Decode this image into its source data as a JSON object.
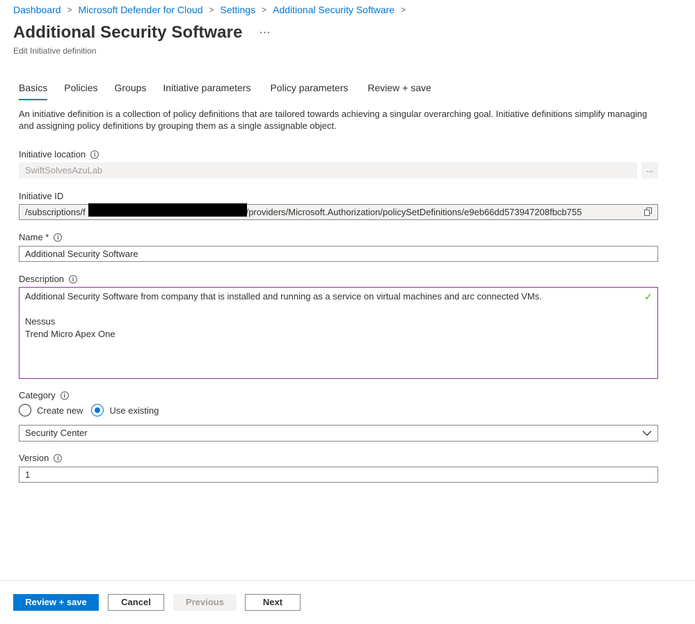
{
  "breadcrumb": [
    "Dashboard",
    "Microsoft Defender for Cloud",
    "Settings",
    "Additional Security Software"
  ],
  "page": {
    "title": "Additional Security Software",
    "more_label": "···",
    "subtitle": "Edit Initiative definition"
  },
  "tabs": [
    {
      "label": "Basics",
      "active": true
    },
    {
      "label": "Policies",
      "active": false
    },
    {
      "label": "Groups",
      "active": false
    },
    {
      "label": "Initiative parameters",
      "active": false
    },
    {
      "label": "Policy parameters",
      "active": false
    },
    {
      "label": "Review + save",
      "active": false
    }
  ],
  "intro": "An initiative definition is a collection of policy definitions that are tailored towards achieving a singular overarching goal. Initiative definitions simplify managing and assigning policy definitions by grouping them as a single assignable object.",
  "form": {
    "location": {
      "label": "Initiative location",
      "value": "SwiftSolvesAzuLab",
      "button": "..."
    },
    "initiative_id": {
      "label": "Initiative ID",
      "prefix": "/subscriptions/f",
      "suffix": "l/providers/Microsoft.Authorization/policySetDefinitions/e9eb66dd573947208fbcb755"
    },
    "name": {
      "label": "Name *",
      "value": "Additional Security Software"
    },
    "description": {
      "label": "Description",
      "lines": [
        "Additional Security Software from company that is installed and running as a service on virtual machines and arc connected VMs.",
        "",
        "Nessus",
        "Trend Micro Apex One"
      ]
    },
    "category": {
      "label": "Category",
      "options": [
        "Create new",
        "Use existing"
      ],
      "selected_option": "Use existing",
      "value": "Security Center"
    },
    "version": {
      "label": "Version",
      "value": "1"
    }
  },
  "footer": {
    "review_save": "Review + save",
    "cancel": "Cancel",
    "previous": "Previous",
    "next": "Next"
  },
  "colors": {
    "accent": "#0078d4",
    "focus_border": "#8a2da5",
    "valid_check": "#57a300"
  }
}
